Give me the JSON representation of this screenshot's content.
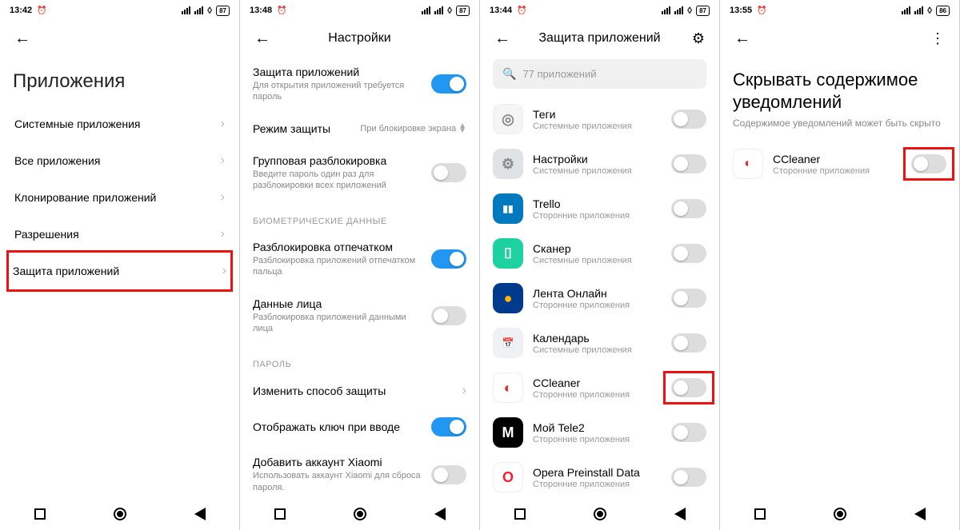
{
  "screens": [
    {
      "statusbar": {
        "time": "13:42",
        "battery": "87"
      },
      "title": "Приложения",
      "menu": [
        {
          "label": "Системные приложения"
        },
        {
          "label": "Все приложения"
        },
        {
          "label": "Клонирование приложений"
        },
        {
          "label": "Разрешения"
        },
        {
          "label": "Защита приложений",
          "highlight": true
        }
      ]
    },
    {
      "statusbar": {
        "time": "13:48",
        "battery": "87"
      },
      "header_title": "Настройки",
      "rows": [
        {
          "label": "Защита приложений",
          "sub": "Для открытия приложений требуется пароль",
          "toggle": true,
          "on": true
        },
        {
          "label": "Режим защиты",
          "value": "При блокировке экрана"
        },
        {
          "label": "Групповая разблокировка",
          "sub": "Введите пароль один раз для разблокировки всех приложений",
          "toggle": true,
          "on": false
        }
      ],
      "section1": "БИОМЕТРИЧЕСКИЕ ДАННЫЕ",
      "rows2": [
        {
          "label": "Разблокировка отпечатком",
          "sub": "Разблокировка приложений отпечатком пальца",
          "toggle": true,
          "on": true
        },
        {
          "label": "Данные лица",
          "sub": "Разблокировка приложений данными лица",
          "toggle": true,
          "on": false
        }
      ],
      "section2": "ПАРОЛЬ",
      "rows3": [
        {
          "label": "Изменить способ защиты",
          "chev": true
        },
        {
          "label": "Отображать ключ при вводе",
          "toggle": true,
          "on": true
        },
        {
          "label": "Добавить аккаунт Xiaomi",
          "sub": "Использовать аккаунт Xiaomi для сброса пароля.",
          "toggle": true,
          "on": false
        }
      ]
    },
    {
      "statusbar": {
        "time": "13:44",
        "battery": "87"
      },
      "header_title": "Защита приложений",
      "search_placeholder": "77 приложений",
      "apps": [
        {
          "name": "Теги",
          "sub": "Системные приложения",
          "bg": "#f5f5f5",
          "fg": "#888",
          "glyph": "◎"
        },
        {
          "name": "Настройки",
          "sub": "Системные приложения",
          "bg": "#dfe3e6",
          "fg": "#888",
          "glyph": "⚙"
        },
        {
          "name": "Trello",
          "sub": "Сторонние приложения",
          "bg": "#0079bf",
          "fg": "#fff",
          "glyph": "▮▮"
        },
        {
          "name": "Сканер",
          "sub": "Системные приложения",
          "bg": "#1dd1a1",
          "fg": "#fff",
          "glyph": "⌷"
        },
        {
          "name": "Лента Онлайн",
          "sub": "Сторонние приложения",
          "bg": "#003a8c",
          "fg": "#ffb400",
          "glyph": "●"
        },
        {
          "name": "Календарь",
          "sub": "Системные приложения",
          "bg": "#eef2f5",
          "fg": "#4a90e2",
          "glyph": "📅"
        },
        {
          "name": "CCleaner",
          "sub": "Сторонние приложения",
          "bg": "#fff",
          "fg": "#d33",
          "glyph": "◐",
          "hl": true
        },
        {
          "name": "Мой Tele2",
          "sub": "Сторонние приложения",
          "bg": "#000",
          "fg": "#fff",
          "glyph": "M"
        },
        {
          "name": "Opera Preinstall Data",
          "sub": "Сторонние приложения",
          "bg": "#fff",
          "fg": "#ff1b2d",
          "glyph": "O"
        }
      ]
    },
    {
      "statusbar": {
        "time": "13:55",
        "battery": "86"
      },
      "title": "Скрывать содержимое уведомлений",
      "subtitle": "Содержимое уведомлений может быть скрыто",
      "app": {
        "name": "CCleaner",
        "sub": "Сторонние приложения",
        "bg": "#fff",
        "fg": "#d33",
        "glyph": "◐",
        "hl": true
      }
    }
  ]
}
